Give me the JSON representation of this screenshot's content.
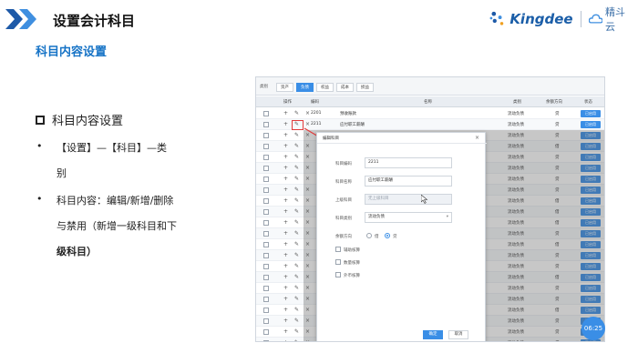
{
  "header": {
    "title": "设置会计科目",
    "subtitle": "科目内容设置",
    "logo_text": "Kingdee",
    "logo_cloud_text": "精斗云"
  },
  "content": {
    "heading": "科目内容设置",
    "bullet1_line1": "【设置】—【科目】—类",
    "bullet1_line2": "别",
    "bullet2_line1": "科目内容：编辑/新增/删除",
    "bullet2_line2": "与禁用（新增一级科目和下",
    "bullet2_line3": "级科目）"
  },
  "screenshot": {
    "tabs_lead": "类别",
    "tabs": [
      "资产",
      "负债",
      "权益",
      "成本",
      "损益"
    ],
    "active_tab": "负债",
    "columns": {
      "op": "操作",
      "code": "编码",
      "name": "名称",
      "category": "类别",
      "direction": "余额方向",
      "status": "状态"
    },
    "rows": [
      {
        "code": "2201",
        "name": "预收账款",
        "category": "流动负债",
        "direction": "贷",
        "status": "已启用"
      },
      {
        "code": "2211",
        "name": "应付职工薪酬",
        "category": "流动负债",
        "direction": "贷",
        "status": "已启用"
      },
      {
        "code": "",
        "name": "",
        "category": "流动负债",
        "direction": "贷",
        "status": "已启用"
      },
      {
        "code": "",
        "name": "",
        "category": "流动负债",
        "direction": "借",
        "status": "已启用"
      },
      {
        "code": "",
        "name": "",
        "category": "流动负债",
        "direction": "贷",
        "status": "已启用"
      },
      {
        "code": "",
        "name": "",
        "category": "流动负债",
        "direction": "贷",
        "status": "已启用"
      },
      {
        "code": "",
        "name": "",
        "category": "流动负债",
        "direction": "贷",
        "status": "已启用"
      },
      {
        "code": "",
        "name": "",
        "category": "流动负债",
        "direction": "贷",
        "status": "已启用"
      },
      {
        "code": "",
        "name": "",
        "category": "流动负债",
        "direction": "借",
        "status": "已启用"
      },
      {
        "code": "",
        "name": "",
        "category": "流动负债",
        "direction": "借",
        "status": "已启用"
      },
      {
        "code": "",
        "name": "",
        "category": "流动负债",
        "direction": "借",
        "status": "已启用"
      },
      {
        "code": "",
        "name": "",
        "category": "流动负债",
        "direction": "贷",
        "status": "已启用"
      },
      {
        "code": "",
        "name": "",
        "category": "流动负债",
        "direction": "借",
        "status": "已启用"
      },
      {
        "code": "",
        "name": "",
        "category": "流动负债",
        "direction": "贷",
        "status": "已启用"
      },
      {
        "code": "",
        "name": "",
        "category": "流动负债",
        "direction": "贷",
        "status": "已启用"
      },
      {
        "code": "",
        "name": "",
        "category": "流动负债",
        "direction": "借",
        "status": "已启用"
      },
      {
        "code": "",
        "name": "",
        "category": "流动负债",
        "direction": "贷",
        "status": "已启用"
      },
      {
        "code": "",
        "name": "",
        "category": "流动负债",
        "direction": "贷",
        "status": "已启用"
      },
      {
        "code": "",
        "name": "",
        "category": "流动负债",
        "direction": "借",
        "status": "已启用"
      },
      {
        "code": "",
        "name": "",
        "category": "流动负债",
        "direction": "贷",
        "status": "已启用"
      },
      {
        "code": "",
        "name": "",
        "category": "流动负债",
        "direction": "贷",
        "status": "已启用"
      },
      {
        "code": "",
        "name": "",
        "category": "流动负债",
        "direction": "借",
        "status": "已启用"
      }
    ],
    "dialog": {
      "title": "编辑科目",
      "code_label": "科目编码",
      "code_value": "2211",
      "name_label": "科目名称",
      "name_value": "应付职工薪酬",
      "parent_label": "上级科目",
      "parent_placeholder": "无上级科目",
      "category_label": "科目类别",
      "category_value": "流动负债",
      "direction_label": "余额方向",
      "direction_debit": "借",
      "direction_credit": "贷",
      "aux_label": "辅助核算",
      "qty_label": "数量核算",
      "fx_label": "外币核算",
      "ok_label": "确定",
      "cancel_label": "取消"
    },
    "time_badge": "06:25"
  }
}
